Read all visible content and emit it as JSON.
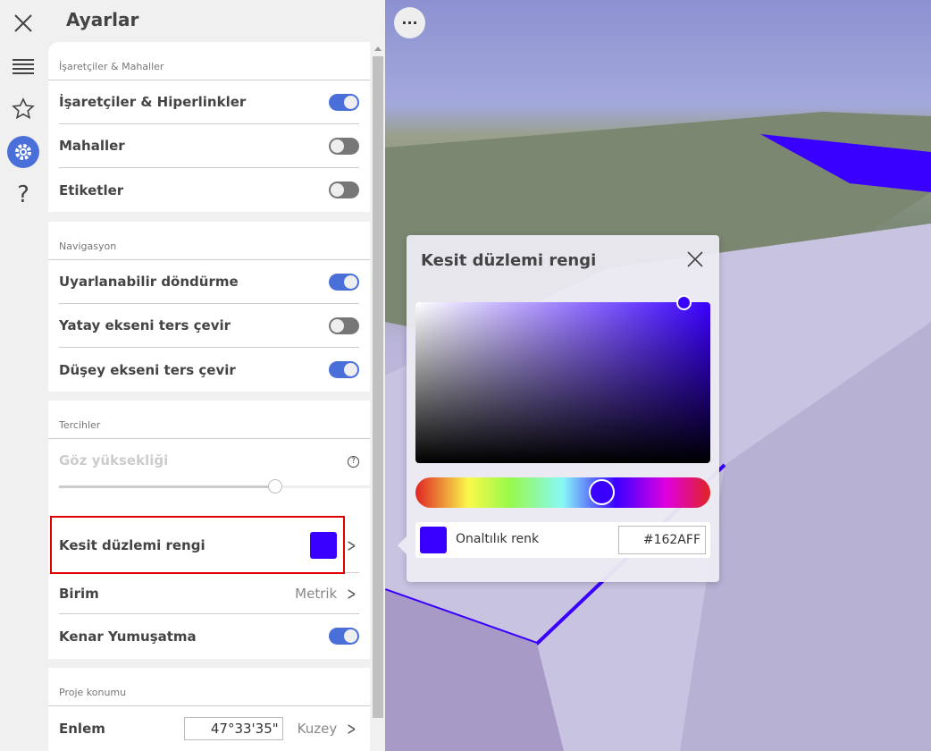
{
  "rail": {
    "icons": [
      "close-icon",
      "list-icon",
      "star-icon",
      "gear-icon",
      "help-icon"
    ]
  },
  "panel": {
    "title": "Ayarlar",
    "sections": [
      {
        "header": "İşaretçiler & Mahaller",
        "rows": [
          {
            "label": "İşaretçiler & Hiperlinkler",
            "on": true
          },
          {
            "label": "Mahaller",
            "on": false
          },
          {
            "label": "Etiketler",
            "on": false
          }
        ]
      },
      {
        "header": "Navigasyon",
        "rows": [
          {
            "label": "Uyarlanabilir döndürme",
            "on": true
          },
          {
            "label": "Yatay ekseni ters çevir",
            "on": false
          },
          {
            "label": "Düşey ekseni ters çevir",
            "on": true
          }
        ]
      },
      {
        "header": "Tercihler",
        "eye_height": {
          "label": "Göz yüksekliği",
          "value_fraction": 0.67
        },
        "section_color": {
          "label": "Kesit düzlemi rengi",
          "color": "#3A00FF"
        },
        "unit": {
          "label": "Birim",
          "value": "Metrik"
        },
        "antialias": {
          "label": "Kenar Yumuşatma",
          "on": true
        }
      },
      {
        "header": "Proje konumu",
        "latitude": {
          "label": "Enlem",
          "value": "47°33'35\"",
          "direction": "Kuzey"
        }
      }
    ]
  },
  "viewport": {
    "more_label": "···"
  },
  "color_popup": {
    "title": "Kesit düzlemi rengi",
    "hex_label": "Onaltılık renk",
    "hex_value": "#162AFF",
    "hue_fraction": 0.63
  }
}
